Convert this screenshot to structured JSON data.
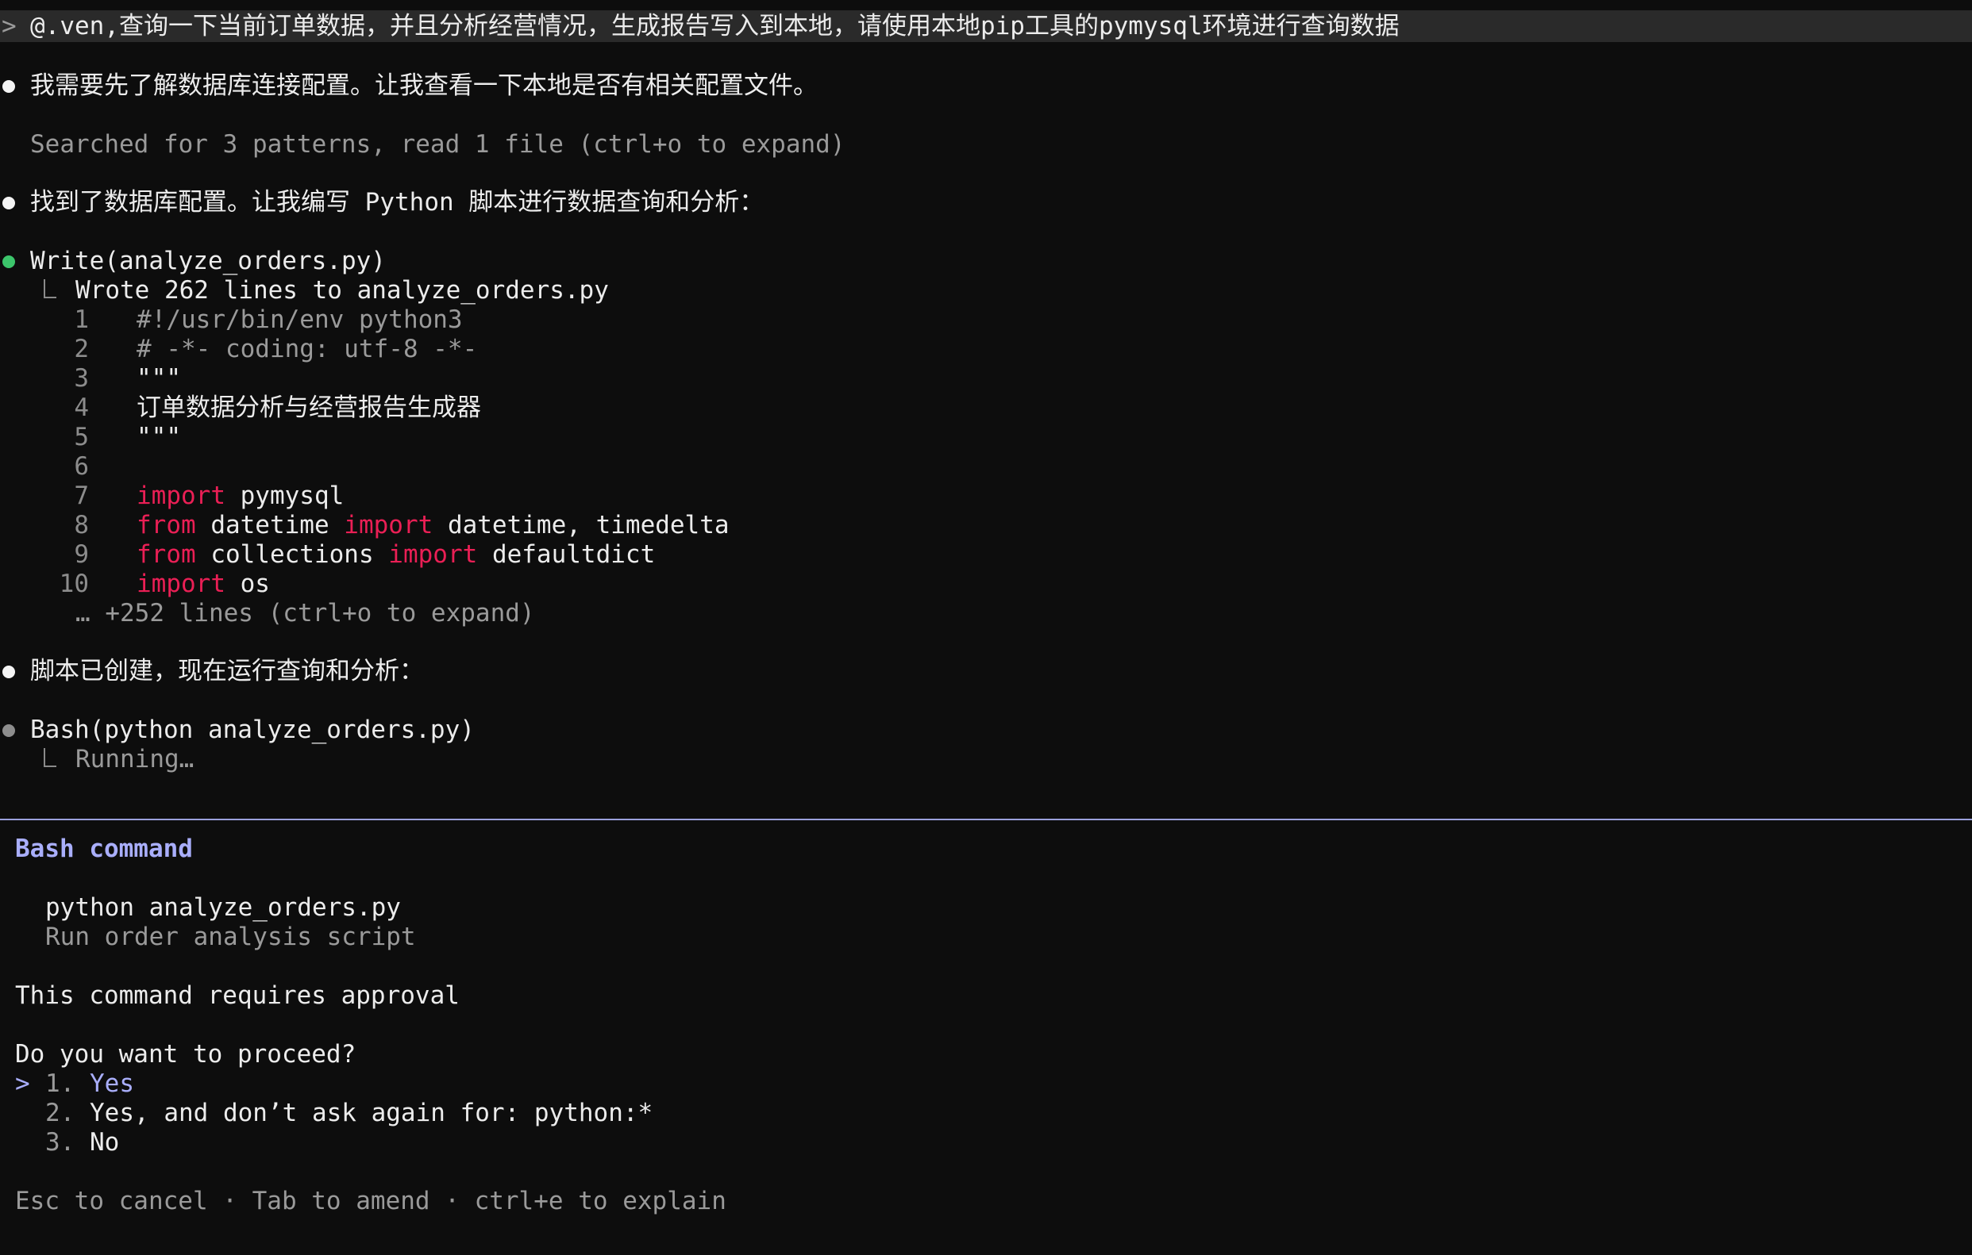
{
  "prompt": {
    "marker": ">",
    "text": "@.ven,查询一下当前订单数据，并且分析经营情况，生成报告写入到本地，请使用本地pip工具的pymysql环境进行查询数据"
  },
  "messages": {
    "m1": "我需要先了解数据库连接配置。让我查看一下本地是否有相关配置文件。",
    "search_summary": "Searched for 3 patterns, read 1 file (ctrl+o to expand)",
    "m2": "找到了数据库配置。让我编写 Python 脚本进行数据查询和分析：",
    "m3": "脚本已创建，现在运行查询和分析："
  },
  "write_tool": {
    "name": "Write",
    "arg": "(analyze_orders.py)",
    "result": "Wrote 262 lines to analyze_orders.py",
    "code": [
      {
        "n": "1",
        "text": "#!/usr/bin/env python3"
      },
      {
        "n": "2",
        "text": "# -*- coding: utf-8 -*-"
      },
      {
        "n": "3",
        "text": "\"\"\""
      },
      {
        "n": "4",
        "text": "订单数据分析与经营报告生成器"
      },
      {
        "n": "5",
        "text": "\"\"\""
      },
      {
        "n": "6",
        "text": ""
      },
      {
        "n": "7",
        "kw1": "import",
        "rest1": " pymysql"
      },
      {
        "n": "8",
        "kw1": "from",
        "rest1": " datetime ",
        "kw2": "import",
        "rest2": " datetime, timedelta"
      },
      {
        "n": "9",
        "kw1": "from",
        "rest1": " collections ",
        "kw2": "import",
        "rest2": " defaultdict"
      },
      {
        "n": "10",
        "kw1": "import",
        "rest1": " os"
      }
    ],
    "more": "… +252 lines (ctrl+o to expand)"
  },
  "bash_tool": {
    "name": "Bash",
    "arg": "(python analyze_orders.py)",
    "status": "Running…"
  },
  "approval": {
    "title": "Bash command",
    "command": "python analyze_orders.py",
    "description": "Run order analysis script",
    "requirement": "This command requires approval",
    "question": "Do you want to proceed?",
    "cursor": ">",
    "options": [
      {
        "num": "1.",
        "label": "Yes"
      },
      {
        "num": "2.",
        "label": "Yes, and don’t ask again for: python:*"
      },
      {
        "num": "3.",
        "label": "No"
      }
    ],
    "footer": "Esc to cancel · Tab to amend · ctrl+e to explain"
  },
  "colors": {
    "background": "#0d0d0d",
    "keyword": "#ea1f55",
    "accent": "#a9aefb",
    "success_dot": "#3cc56b"
  }
}
